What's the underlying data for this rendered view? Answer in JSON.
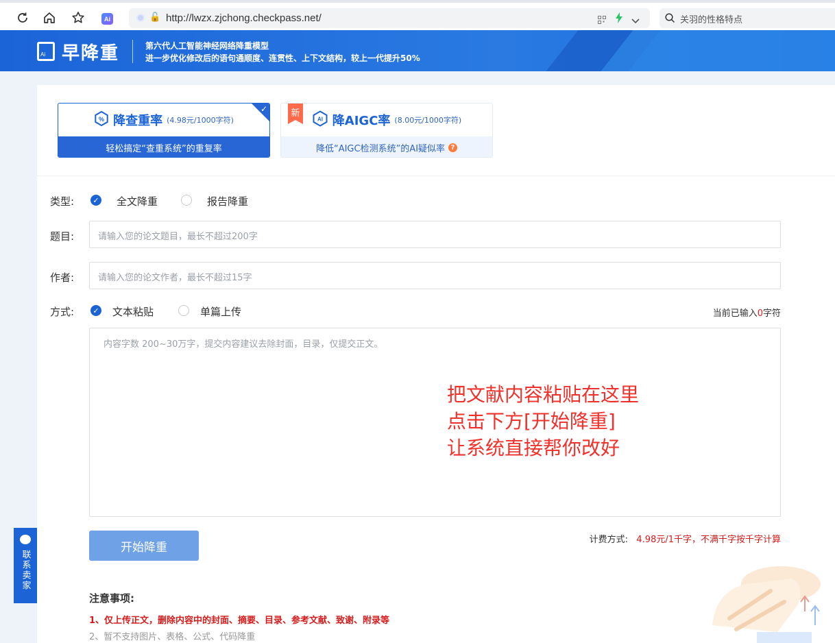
{
  "browser": {
    "url": "http://lwzx.zjchong.checkpass.net/",
    "search_placeholder": "关羽的性格特点",
    "ai_label": "Ai"
  },
  "banner": {
    "logo_text": "早降重",
    "line1": "第六代人工智能神经网络降重模型",
    "line2": "进一步优化修改后的语句通顺度、连贯性、上下文结构，较上一代提升50%"
  },
  "cards": [
    {
      "title": "降查重率",
      "price": "(4.98元/1000字符)",
      "subtitle": "轻松搞定“查重系统”的重复率"
    },
    {
      "title": "降AIGC率",
      "price": "(8.00元/1000字符)",
      "subtitle": "降低“AIGC检测系统”的AI疑似率",
      "badge": "新"
    }
  ],
  "form": {
    "type_label": "类型:",
    "type_options": [
      "全文降重",
      "报告降重"
    ],
    "title_label": "题目:",
    "title_placeholder": "请输入您的论文题目，最长不超过200字",
    "author_label": "作者:",
    "author_placeholder": "请输入您的论文作者，最长不超过15字",
    "mode_label": "方式:",
    "mode_options": [
      "文本粘贴",
      "单篇上传"
    ],
    "counter_prefix": "当前已输入",
    "counter_value": "0",
    "counter_suffix": "字符",
    "content_placeholder": "内容字数 200~30万字，提交内容建议去除封面，目录，仅提交正文。",
    "overlay_lines": [
      "把文献内容粘贴在这里",
      "点击下方[开始降重]",
      "让系统直接帮你改好"
    ],
    "start_button": "开始降重",
    "billing_label": "计费方式:",
    "billing_value": "4.98元/1千字，不满千字按千字计算"
  },
  "notice": {
    "title": "注意事项:",
    "items": [
      "1、仅上传正文，删除内容中的封面、摘要、目录、参考文献、致谢、附录等",
      "2、暂不支持图片、表格、公式、代码降重"
    ]
  },
  "contact": {
    "label": "联系卖家"
  },
  "colors": {
    "primary": "#1c63d6",
    "danger": "#d51c1c",
    "overlay": "#f0302a"
  }
}
